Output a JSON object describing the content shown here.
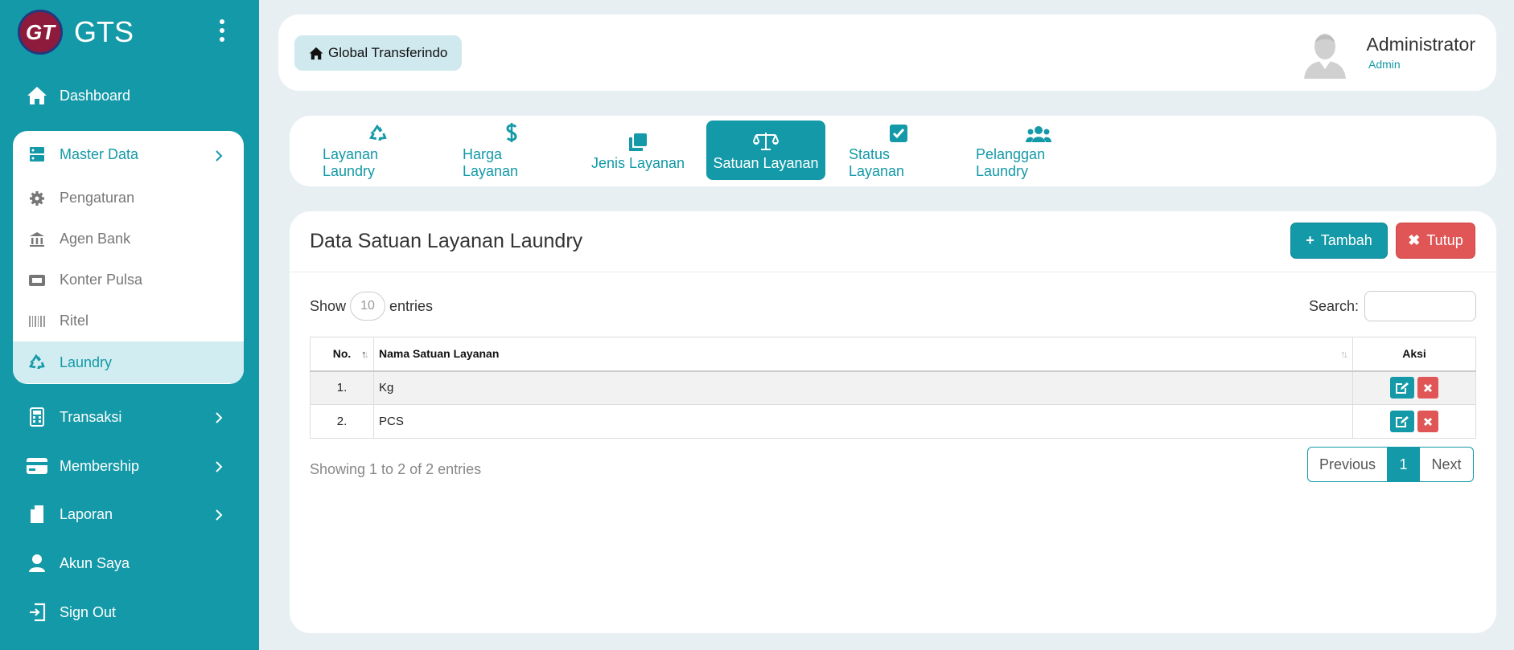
{
  "brand": {
    "logo_text": "GT",
    "name": "GTS"
  },
  "colors": {
    "primary": "#1399a7",
    "danger": "#e05656",
    "active_bg": "#d2edf1"
  },
  "sidebar": {
    "dashboard": "Dashboard",
    "master_data": {
      "label": "Master Data",
      "items": [
        {
          "label": "Pengaturan",
          "icon": "gear-icon"
        },
        {
          "label": "Agen Bank",
          "icon": "bank-icon"
        },
        {
          "label": "Konter Pulsa",
          "icon": "ticket-icon"
        },
        {
          "label": "Ritel",
          "icon": "barcode-icon"
        },
        {
          "label": "Laundry",
          "icon": "recycle-icon",
          "active": true
        }
      ]
    },
    "transaksi": "Transaksi",
    "membership": "Membership",
    "laporan": "Laporan",
    "akun_saya": "Akun Saya",
    "sign_out": "Sign Out"
  },
  "header": {
    "breadcrumb": "Global Transferindo",
    "user_name": "Administrator",
    "user_role": "Admin"
  },
  "tabs": [
    {
      "label": "Layanan Laundry",
      "icon": "recycle-icon"
    },
    {
      "label": "Harga Layanan",
      "icon": "dollar-icon"
    },
    {
      "label": "Jenis Layanan",
      "icon": "clone-icon"
    },
    {
      "label": "Satuan Layanan",
      "icon": "scale-icon",
      "active": true
    },
    {
      "label": "Status Layanan",
      "icon": "check-square-icon"
    },
    {
      "label": "Pelanggan Laundry",
      "icon": "users-icon"
    }
  ],
  "card": {
    "title": "Data Satuan Layanan Laundry",
    "add_label": "Tambah",
    "close_label": "Tutup"
  },
  "datatable": {
    "show_label": "Show",
    "page_length": "10",
    "entries_label": "entries",
    "search_label": "Search:",
    "search_value": "",
    "columns": [
      "No.",
      "Nama Satuan Layanan",
      "Aksi"
    ],
    "rows": [
      {
        "no": "1.",
        "name": "Kg"
      },
      {
        "no": "2.",
        "name": "PCS"
      }
    ],
    "info": "Showing 1 to 2 of 2 entries",
    "pagination": {
      "previous": "Previous",
      "current": "1",
      "next": "Next"
    }
  }
}
